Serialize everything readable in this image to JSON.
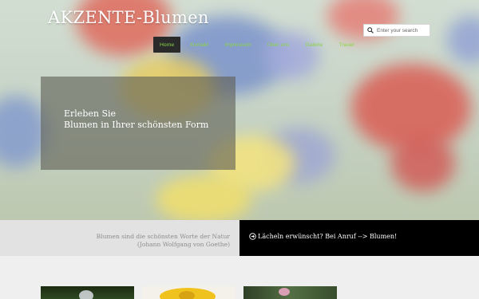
{
  "brand": {
    "logo": "AKZENTE-Blumen"
  },
  "search": {
    "placeholder": "Enter your search"
  },
  "nav": {
    "items": [
      "Home",
      "Kontakt",
      "Impressum",
      "Über uns",
      "Galerie",
      "Trauer"
    ],
    "active_index": 0
  },
  "teaser": {
    "line1": "Erleben Sie",
    "line2": "Blumen in Ihrer schönsten Form"
  },
  "quote": {
    "line1": "Blumen sind die schönsten Worte der Natur",
    "line2": "(Johann Wolfgang von Goethe)"
  },
  "cta": {
    "text": "Lächeln erwünscht? Bei Anruf --> Blumen!"
  },
  "colors": {
    "nav_text": "#8bd548",
    "nav_active_bg": "#2a2a2a",
    "cta_bg": "#000000",
    "quote_bg": "#e2e2e2"
  },
  "icons": {
    "search": "search-icon",
    "cta": "circle-arrow-icon"
  }
}
